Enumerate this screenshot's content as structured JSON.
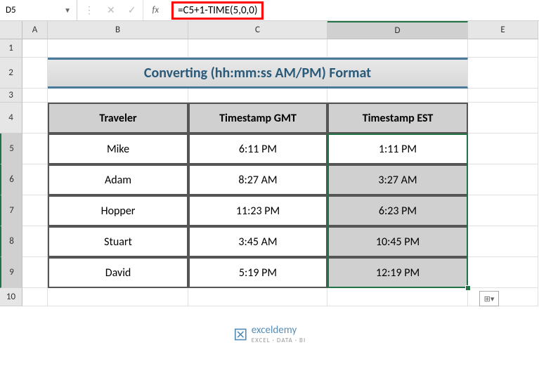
{
  "nameBox": "D5",
  "formula": "=C5+1-TIME(5,0,0)",
  "columns": [
    "A",
    "B",
    "C",
    "D",
    "E"
  ],
  "rows": [
    "1",
    "2",
    "3",
    "4",
    "5",
    "6",
    "7",
    "8",
    "9",
    "10"
  ],
  "title": "Converting (hh:mm:ss AM/PM) Format",
  "headers": {
    "traveler": "Traveler",
    "gmt": "Timestamp GMT",
    "est": "Timestamp EST"
  },
  "data": [
    {
      "traveler": "Mike",
      "gmt": "6:11 PM",
      "est": "1:11 PM"
    },
    {
      "traveler": "Adam",
      "gmt": "8:27 AM",
      "est": "3:27 AM"
    },
    {
      "traveler": "Hopper",
      "gmt": "11:23 PM",
      "est": "6:23 PM"
    },
    {
      "traveler": "Stuart",
      "gmt": "3:45 AM",
      "est": "10:45 PM"
    },
    {
      "traveler": "David",
      "gmt": "5:19 PM",
      "est": "12:19 PM"
    }
  ],
  "watermark": {
    "name": "exceldemy",
    "sub": "EXCEL · DATA · BI"
  }
}
